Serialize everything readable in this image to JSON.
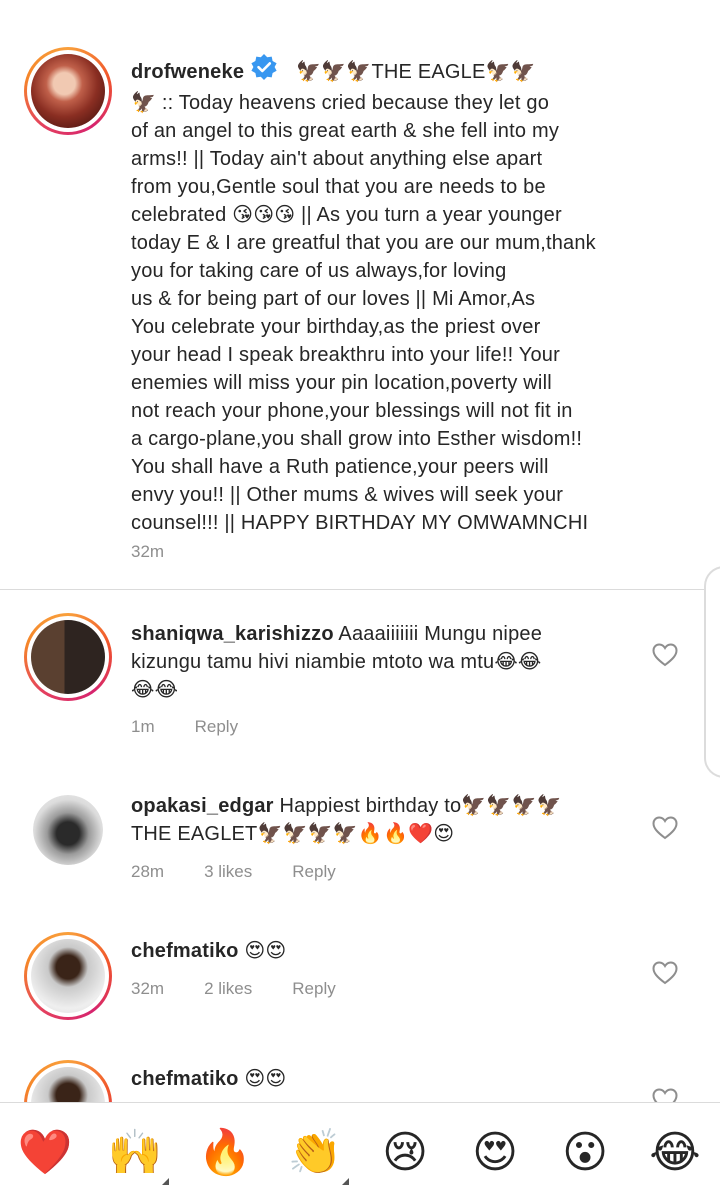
{
  "caption": {
    "username": "drofweneke",
    "verified": true,
    "lines": [
      "🦅🦅🦅THE EAGLE🦅🦅",
      "🦅 :: Today heavens cried because they let go",
      "of an angel to this great earth & she fell into my",
      "arms!! || Today ain't about anything else apart",
      "from you,Gentle soul that you are needs to be",
      "celebrated 😘😘😘 || As you turn a year younger",
      "today E & I are greatful that you are our mum,thank",
      "you for taking care of us always,for loving",
      "us & for being part of our loves || Mi Amor,As",
      "You celebrate your birthday,as the priest over",
      "your head I speak breakthru into your life!! Your",
      "enemies will miss your pin location,poverty will",
      "not reach your phone,your blessings will not fit in",
      "a cargo-plane,you shall grow into Esther wisdom!!",
      "You shall have a Ruth patience,your peers will",
      "envy you!! || Other mums & wives will seek your",
      "counsel!!! || HAPPY BIRTHDAY MY OMWAMNCHI"
    ],
    "time": "32m"
  },
  "comments": [
    {
      "username": "shaniqwa_karishizzo",
      "lines": [
        "Aaaaiiiiiii Mungu nipee",
        "kizungu tamu hivi niambie mtoto wa mtu😂😂",
        "😂😂"
      ],
      "time": "1m",
      "likes": "",
      "reply": "Reply"
    },
    {
      "username": "opakasi_edgar",
      "lines": [
        "Happiest birthday to🦅🦅🦅🦅",
        "THE EAGLET🦅🦅🦅🦅🔥🔥❤️😍"
      ],
      "time": "28m",
      "likes": "3 likes",
      "reply": "Reply"
    },
    {
      "username": "chefmatiko",
      "lines": [
        "😍😍"
      ],
      "time": "32m",
      "likes": "2 likes",
      "reply": "Reply"
    },
    {
      "username": "chefmatiko",
      "lines": [
        "😍😍"
      ],
      "time": "",
      "likes": "",
      "reply": ""
    }
  ],
  "emoji_bar": [
    "❤️",
    "🙌",
    "🔥",
    "👏",
    "😢",
    "😍",
    "😮",
    "😂"
  ],
  "colors": {
    "verified_blue": "#3897f0",
    "meta_gray": "#8e8e8e",
    "heart_red": "#ed4956"
  },
  "icons": {
    "like": "heart-outline-icon",
    "verified": "verified-badge-icon"
  }
}
